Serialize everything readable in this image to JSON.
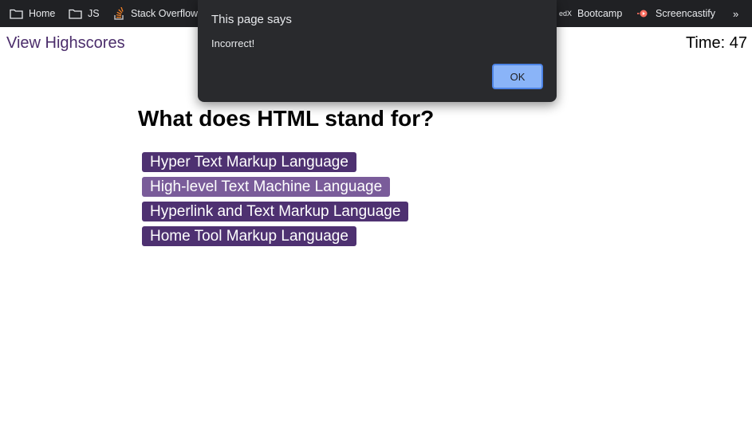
{
  "bookmarks": [
    {
      "label": "Home",
      "icon": "folder-icon"
    },
    {
      "label": "JS",
      "icon": "folder-icon"
    },
    {
      "label": "Stack Overflow",
      "icon": "stackoverflow-icon"
    },
    {
      "label": "Bootcamp",
      "icon": "edx-icon",
      "icon_text": "edX"
    },
    {
      "label": "Screencastify",
      "icon": "screencastify-icon"
    }
  ],
  "bookmarks_more": "»",
  "header": {
    "highscores_link": "View Highscores",
    "timer": "Time: 47"
  },
  "quiz": {
    "question": "What does HTML stand for?",
    "choices": [
      "Hyper Text Markup Language",
      "High-level Text Machine Language",
      "Hyperlink and Text Markup Language",
      "Home Tool Markup Language"
    ],
    "button_color": "#4e3171",
    "button_hover_color": "#7a5c9a"
  },
  "alert": {
    "title": "This page says",
    "message": "Incorrect!",
    "ok_label": "OK"
  }
}
